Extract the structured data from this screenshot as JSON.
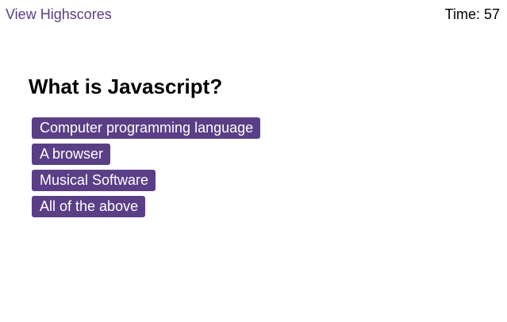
{
  "header": {
    "highscores_link": "View Highscores",
    "timer_label": "Time:",
    "timer_value": "57"
  },
  "quiz": {
    "question": "What is Javascript?",
    "answers": [
      "Computer programming language",
      "A browser",
      "Musical Software",
      "All of the above"
    ]
  },
  "colors": {
    "accent": "#5a3f86",
    "button_text": "#ffffff",
    "background": "#ffffff",
    "text": "#000000"
  }
}
